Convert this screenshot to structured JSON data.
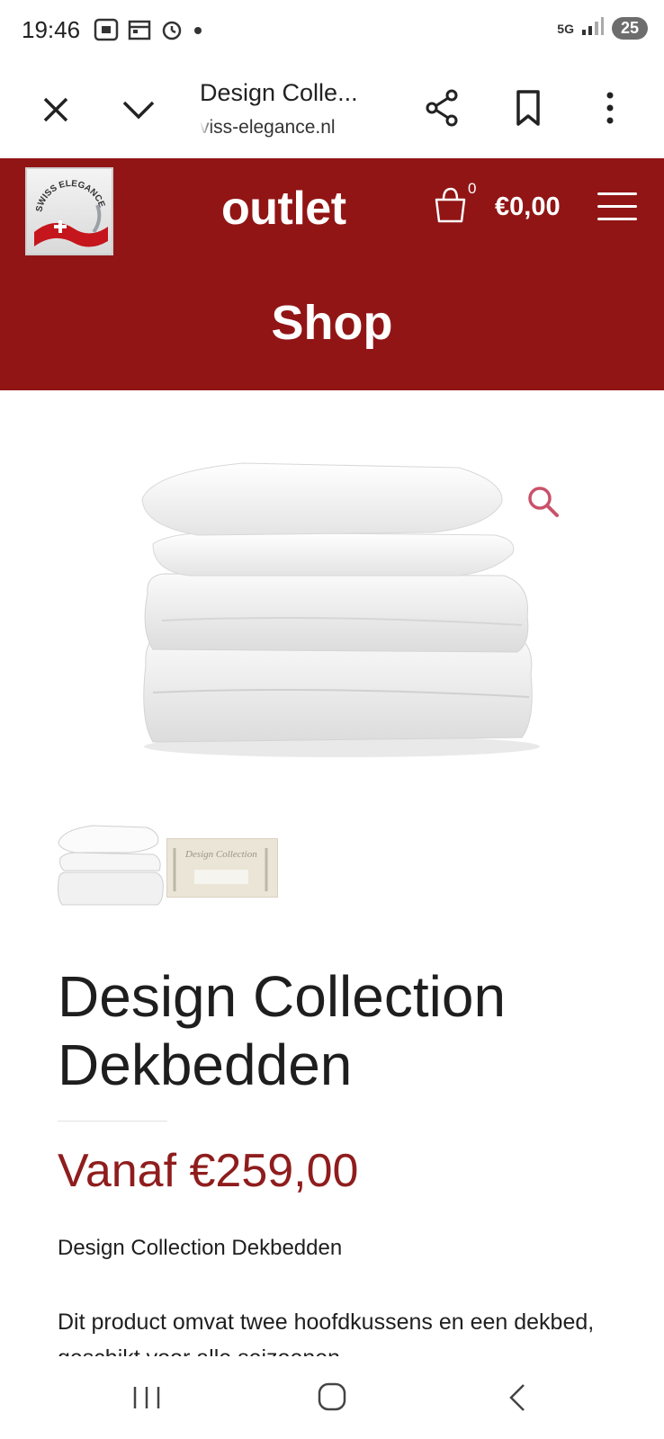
{
  "status_bar": {
    "time": "19:46",
    "network": "5G",
    "battery": "25",
    "icons": [
      "screenshot-icon",
      "calendar-icon",
      "alarm-icon",
      "notification-dot-icon",
      "signal-icon"
    ]
  },
  "browser": {
    "title": "Design Colle...",
    "url": "viss-elegance.nl",
    "icons": [
      "close-icon",
      "chevron-down-icon",
      "share-icon",
      "bookmark-icon",
      "more-vert-icon"
    ]
  },
  "site": {
    "brand_color": "#911515",
    "logo_text": "SWISS ELEGANCE",
    "outlet_label": "outlet",
    "cart_count": "0",
    "cart_total": "€0,00",
    "page_title": "Shop"
  },
  "product": {
    "title": "Design Collection Dekbedden",
    "price": "Vanaf €259,00",
    "price_color": "#8f1d1d",
    "short_title": "Design Collection Dekbedden",
    "description": "Dit product omvat twee hoofdkussens en een dekbed, geschikt voor alle seizoenen.",
    "thumb_box_text": "Design Collection"
  },
  "nav": {
    "icons": [
      "recents-icon",
      "home-icon",
      "back-icon"
    ]
  }
}
